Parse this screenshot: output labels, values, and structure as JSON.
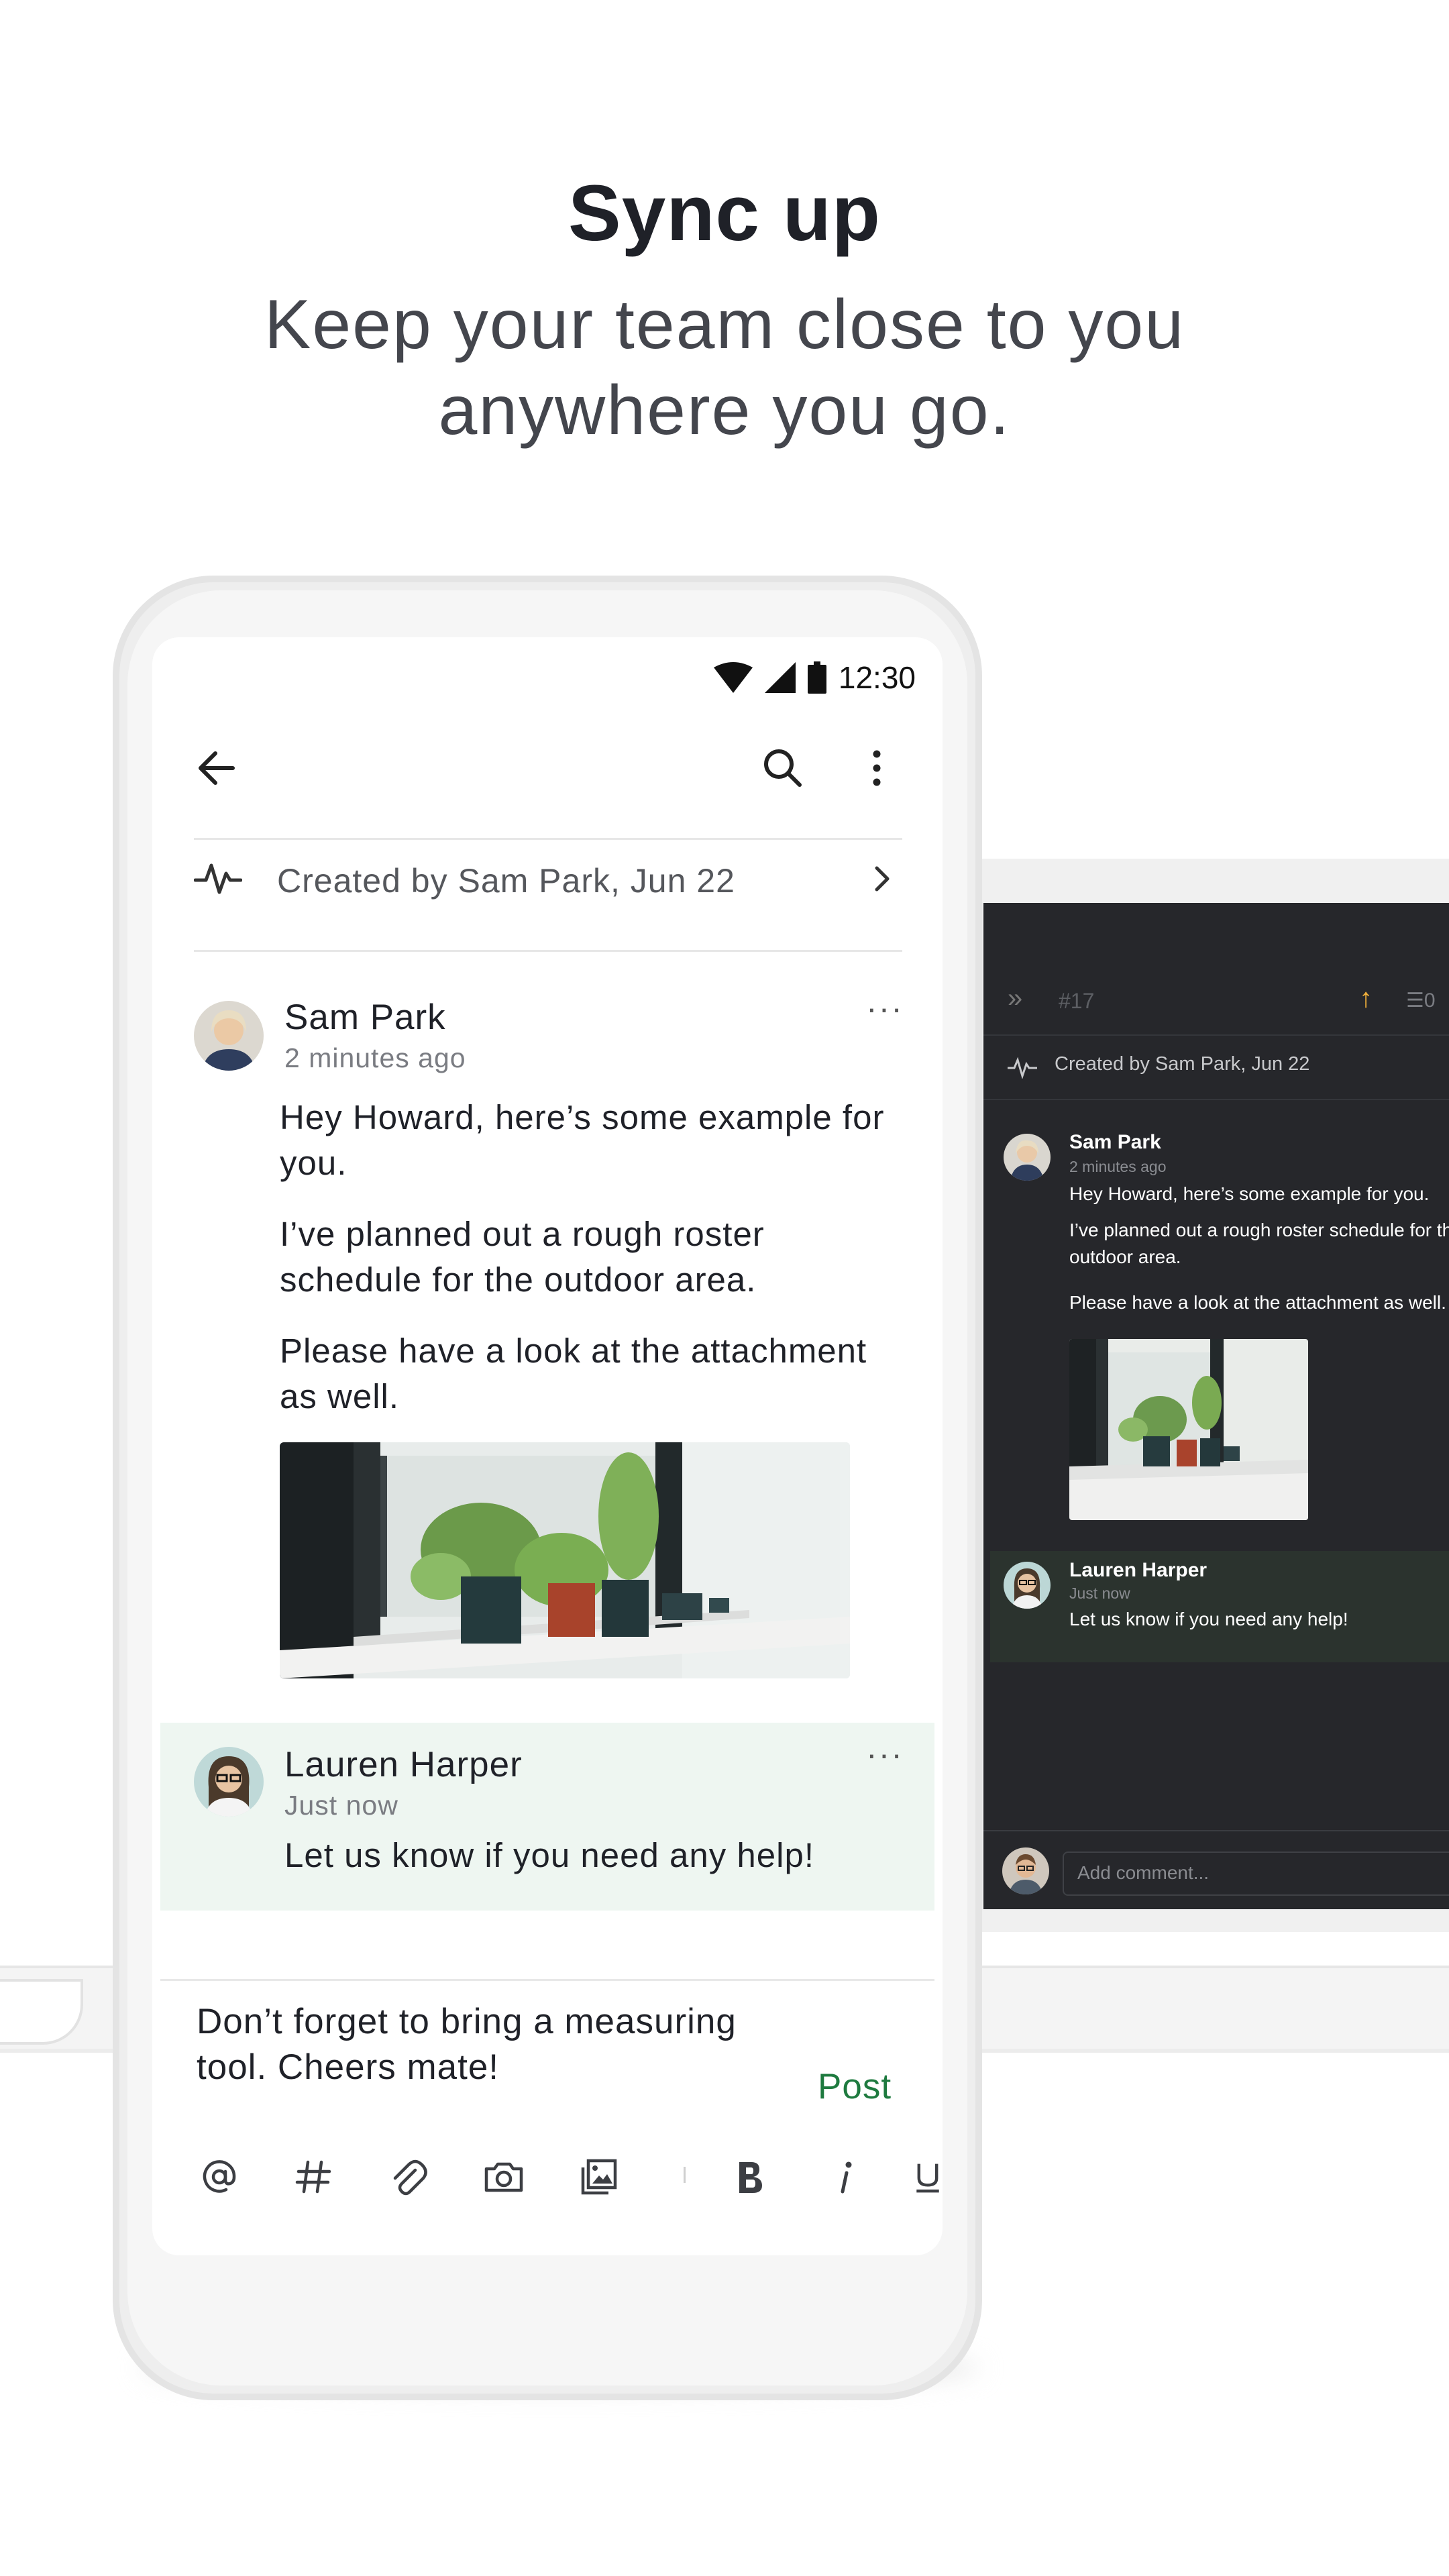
{
  "header": {
    "title": "Sync up",
    "subtitle_line1": "Keep your team close to you",
    "subtitle_line2": "anywhere you go."
  },
  "status_bar": {
    "time": "12:30"
  },
  "thread": {
    "created_label": "Created by Sam Park, Jun 22",
    "messages": [
      {
        "author": "Sam Park",
        "time": "2 minutes ago",
        "paragraphs": [
          "Hey Howard, here’s some example for you.",
          "I’ve planned out a rough roster schedule for the outdoor area.",
          "Please have a look at the attachment as well."
        ]
      },
      {
        "author": "Lauren Harper",
        "time": "Just now",
        "paragraphs": [
          "Let us know if you need any help!"
        ]
      }
    ]
  },
  "composer": {
    "text": "Don’t forget to bring a measuring tool. Cheers mate!",
    "post_label": "Post",
    "tools": [
      "at-icon",
      "hash-icon",
      "attach-icon",
      "camera-icon",
      "gallery-icon",
      "bold-icon",
      "italic-icon",
      "underline-icon"
    ]
  },
  "laptop": {
    "thread_number": "#17",
    "reply_count": "0",
    "created_label": "Created by Sam Park, Jun 22",
    "messages": [
      {
        "author": "Sam Park",
        "time": "2 minutes ago",
        "paragraphs": [
          "Hey Howard, here’s some example for you.",
          "I’ve planned out a rough roster schedule for the outdoor area.",
          "Please have a look at the attachment as well."
        ]
      },
      {
        "author": "Lauren Harper",
        "time": "Just now",
        "paragraphs": [
          "Let us know if you need any help!"
        ]
      }
    ],
    "comment_placeholder": "Add comment..."
  },
  "colors": {
    "accent_green": "#1e7a3f",
    "highlight_bg": "#eef6f1",
    "dark_bg": "#26272b"
  }
}
